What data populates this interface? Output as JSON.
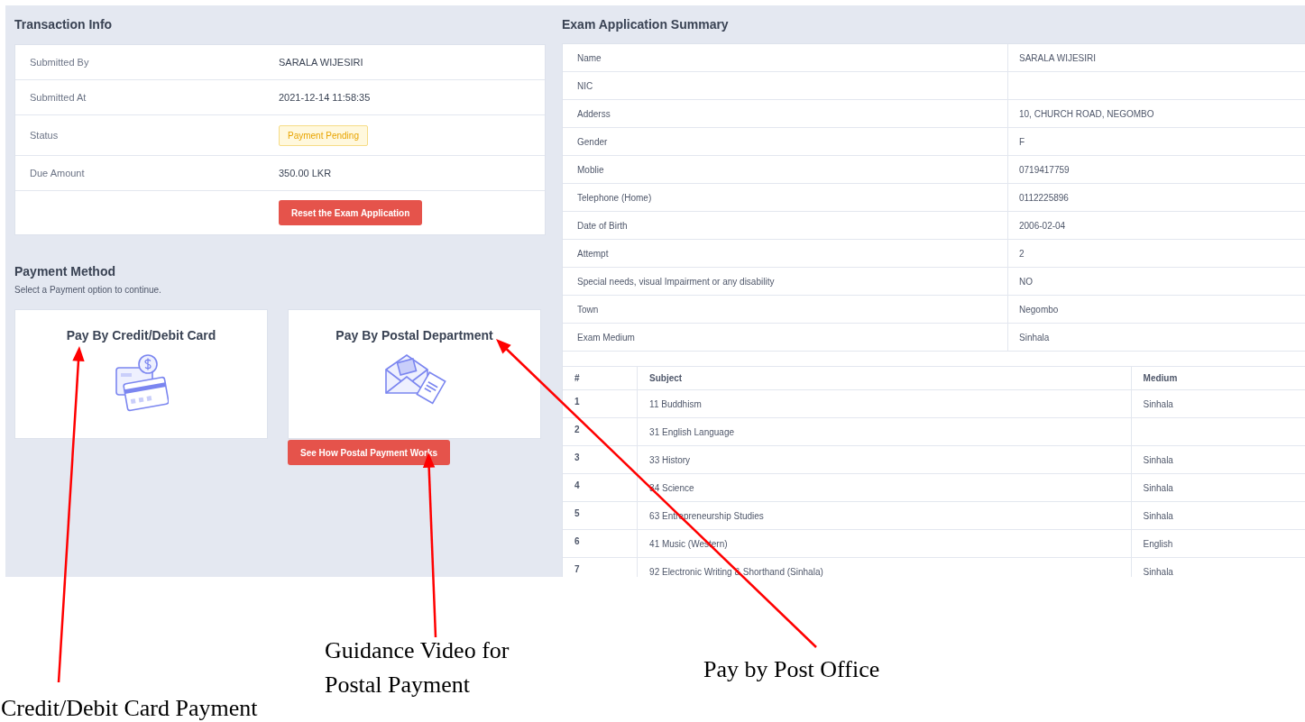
{
  "transaction_info": {
    "title": "Transaction Info",
    "rows": [
      {
        "kind": "text",
        "label": "Submitted By",
        "value": "SARALA WIJESIRI"
      },
      {
        "kind": "text",
        "label": "Submitted At",
        "value": "2021-12-14 11:58:35"
      },
      {
        "kind": "badge",
        "label": "Status",
        "value": "Payment Pending"
      },
      {
        "kind": "text",
        "label": "Due Amount",
        "value": "350.00 LKR"
      },
      {
        "kind": "button",
        "label": "",
        "value": "Reset the Exam Application"
      }
    ]
  },
  "payment_method": {
    "title": "Payment Method",
    "subtitle": "Select a Payment option to continue.",
    "options": [
      {
        "kind": "card",
        "title": "Pay By Credit/Debit Card"
      },
      {
        "kind": "postal",
        "title": "Pay By Postal Department",
        "button": "See How Postal Payment Works"
      }
    ]
  },
  "summary": {
    "title": "Exam Application Summary",
    "rows": [
      {
        "label": "Name",
        "value": "SARALA WIJESIRI"
      },
      {
        "label": "NIC",
        "value": ""
      },
      {
        "label": "Adderss",
        "value": "10, CHURCH ROAD, NEGOMBO"
      },
      {
        "label": "Gender",
        "value": "F"
      },
      {
        "label": "Moblie",
        "value": "0719417759"
      },
      {
        "label": "Telephone (Home)",
        "value": "0112225896"
      },
      {
        "label": "Date of Birth",
        "value": "2006-02-04"
      },
      {
        "label": "Attempt",
        "value": "2"
      },
      {
        "label": "Special needs, visual Impairment or any disability",
        "value": "NO"
      },
      {
        "label": "Town",
        "value": "Negombo"
      },
      {
        "label": "Exam Medium",
        "value": "Sinhala"
      }
    ]
  },
  "subjects": {
    "columns": [
      "#",
      "Subject",
      "Medium"
    ],
    "rows": [
      [
        "1",
        "11 Buddhism",
        "Sinhala"
      ],
      [
        "2",
        "31 English Language",
        ""
      ],
      [
        "3",
        "33 History",
        "Sinhala"
      ],
      [
        "4",
        "34 Science",
        "Sinhala"
      ],
      [
        "5",
        "63 Entrepreneurship Studies",
        "Sinhala"
      ],
      [
        "6",
        "41 Music (Western)",
        "English"
      ],
      [
        "7",
        "92 Electronic Writing & Shorthand (Sinhala)",
        "Sinhala"
      ]
    ]
  },
  "annotations": [
    {
      "kind": "card",
      "text": "Credit/Debit Card Payment"
    },
    {
      "kind": "video",
      "text": "Guidance Video for Postal Payment"
    },
    {
      "kind": "post",
      "text": "Pay by Post Office"
    }
  ]
}
